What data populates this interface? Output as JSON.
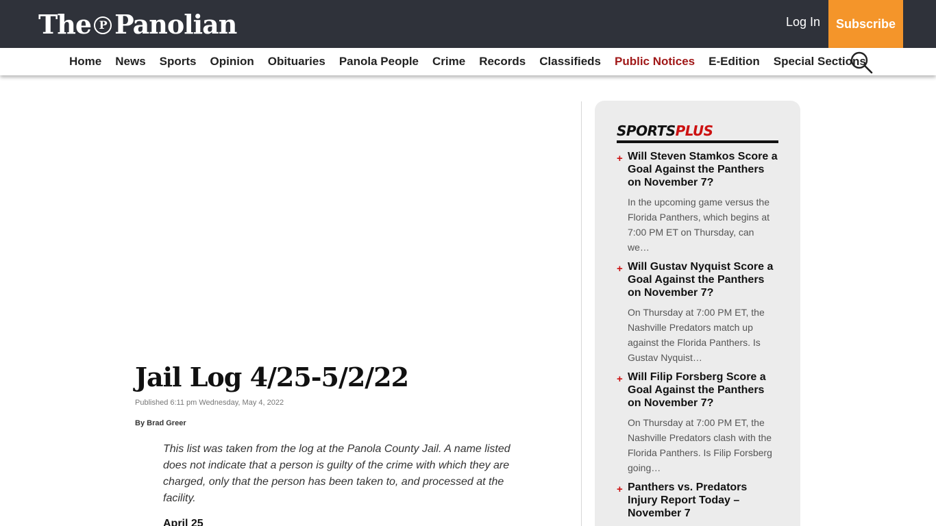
{
  "header": {
    "logo_text_the": "The",
    "logo_seal": "P",
    "logo_text_name": "Panolian",
    "login_label": "Log In",
    "subscribe_label": "Subscribe"
  },
  "nav": {
    "items": [
      "Home",
      "News",
      "Sports",
      "Opinion",
      "Obituaries",
      "Panola People",
      "Crime",
      "Records",
      "Classifieds",
      "Public Notices",
      "E-Edition",
      "Special Sections"
    ],
    "highlighted": "Public Notices",
    "search_icon": "search-icon"
  },
  "article": {
    "title": "Jail Log 4/25-5/2/22",
    "published": "Published 6:11 pm Wednesday, May 4, 2022",
    "byline_prefix": "By",
    "author": "Brad Greer",
    "intro": "This list was taken from the log at the Panola County Jail. A name listed does not indicate that a person is guilty of the crime with which they are charged, only that the person has been taken to, and processed at the facility.",
    "first_subhead": "April 25"
  },
  "sidebar": {
    "title_part1": "SPORTS",
    "title_part2": "PLUS",
    "items": [
      {
        "headline": "Will Steven Stamkos Score a Goal Against the Panthers on November 7?",
        "excerpt": "In the upcoming game versus the Florida Panthers, which begins at 7:00 PM ET on Thursday, can we…"
      },
      {
        "headline": "Will Gustav Nyquist Score a Goal Against the Panthers on November 7?",
        "excerpt": "On Thursday at 7:00 PM ET, the Nashville Predators match up against the Florida Panthers. Is Gustav Nyquist…"
      },
      {
        "headline": "Will Filip Forsberg Score a Goal Against the Panthers on November 7?",
        "excerpt": "On Thursday at 7:00 PM ET, the Nashville Predators clash with the Florida Panthers. Is Filip Forsberg going…"
      },
      {
        "headline": "Panthers vs. Predators Injury Report Today – November 7",
        "excerpt": ""
      }
    ]
  },
  "colors": {
    "topbar": "#2f323a",
    "subscribe": "#f4952a",
    "accent_red": "#cc1111",
    "nav_highlight": "#a01818"
  }
}
